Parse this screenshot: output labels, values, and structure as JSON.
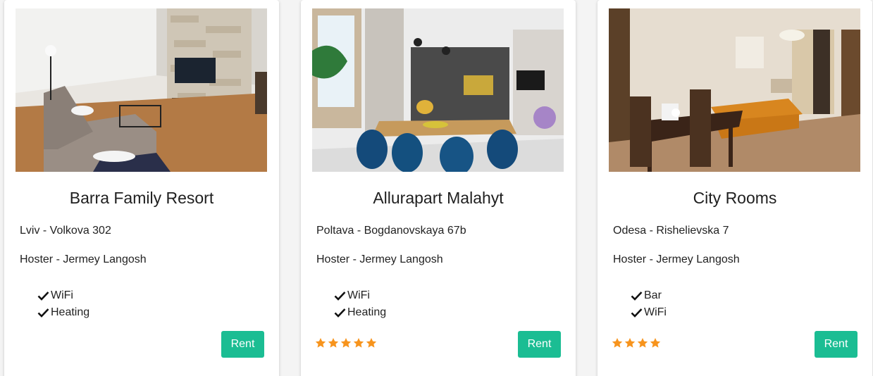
{
  "cards": [
    {
      "title": "Barra Family Resort",
      "address": "Lviv - Volkova 302",
      "hoster": "Hoster - Jermey Langosh",
      "features": [
        "WiFi",
        "Heating"
      ],
      "rating": 0,
      "rent_label": "Rent",
      "photo": "modern-living-room-stone-wall-tv"
    },
    {
      "title": "Allurapart Malahyt",
      "address": "Poltava - Bogdanovskaya 67b",
      "hoster": "Hoster - Jermey Langosh",
      "features": [
        "WiFi",
        "Heating"
      ],
      "rating": 5,
      "rent_label": "Rent",
      "photo": "dining-room-blue-chairs"
    },
    {
      "title": "City Rooms",
      "address": "Odesa - Rishelievska 7",
      "hoster": "Hoster - Jermey Langosh",
      "features": [
        "Bar",
        "WiFi"
      ],
      "rating": 4,
      "rent_label": "Rent",
      "photo": "hotel-room-orange-sofa-dining-table"
    }
  ],
  "colors": {
    "accent": "#1bbd93",
    "star": "#f7941d"
  }
}
